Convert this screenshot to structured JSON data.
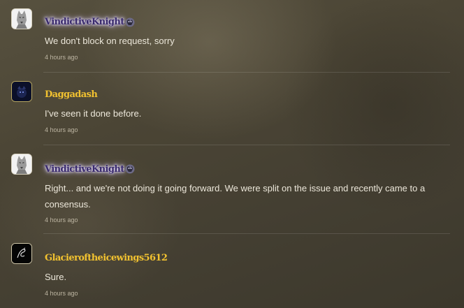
{
  "comments": [
    {
      "username": "VindictiveKnight",
      "username_color": "#3a2b6e",
      "avatar_icon": "wolf-avatar-icon",
      "badge_icon": "moderator-badge-icon",
      "text": "We don't block on request, sorry",
      "timestamp": "4 hours ago"
    },
    {
      "username": "Daggadash",
      "username_color": "#f2c230",
      "avatar_icon": "dark-creature-avatar-icon",
      "text": "I've seen it done before.",
      "timestamp": "4 hours ago"
    },
    {
      "username": "VindictiveKnight",
      "username_color": "#3a2b6e",
      "avatar_icon": "wolf-avatar-icon",
      "badge_icon": "moderator-badge-icon",
      "text": "Right... and we're not doing it going forward. We were split on the issue and recently came to a consensus.",
      "timestamp": "4 hours ago"
    },
    {
      "username": "Glacieroftheicewings5612",
      "username_color": "#f2c230",
      "avatar_icon": "dragon-sketch-avatar-icon",
      "text": "Sure.",
      "timestamp": "4 hours ago"
    }
  ]
}
